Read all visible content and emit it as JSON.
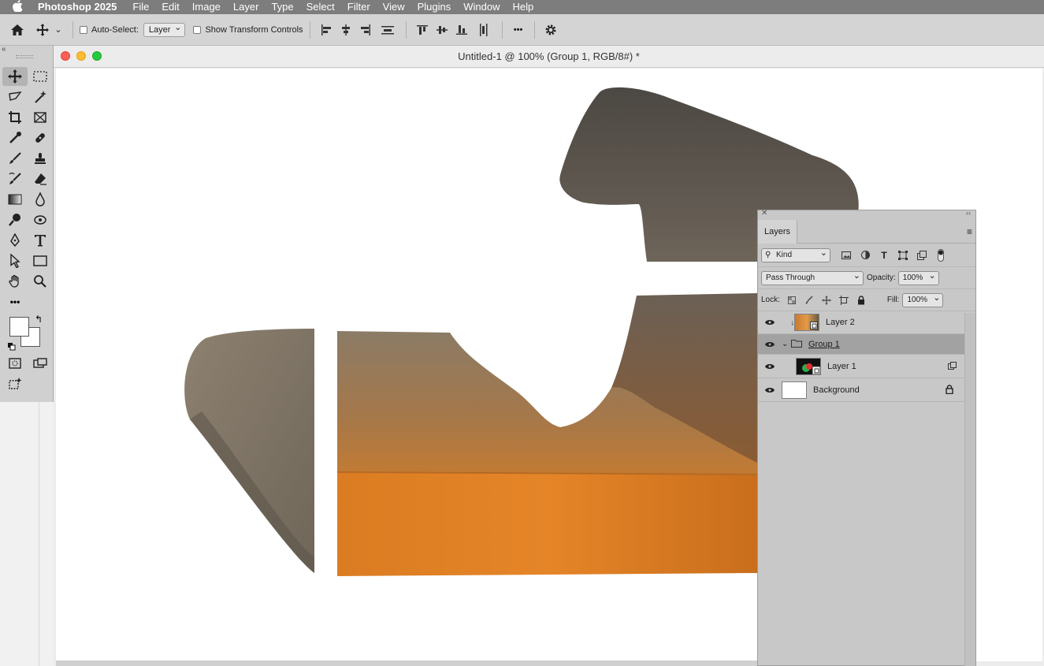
{
  "menubar": {
    "app_name": "Photoshop 2025",
    "items": [
      "File",
      "Edit",
      "Image",
      "Layer",
      "Type",
      "Select",
      "Filter",
      "View",
      "Plugins",
      "Window",
      "Help"
    ]
  },
  "options_bar": {
    "auto_select_label": "Auto-Select:",
    "auto_select_target": "Layer",
    "show_transform_label": "Show Transform Controls",
    "more_label": "•••"
  },
  "document": {
    "title": "Untitled-1 @ 100% (Group 1, RGB/8#) *"
  },
  "layers_panel": {
    "tab_label": "Layers",
    "filter_kind": "Kind",
    "blend_mode": "Pass Through",
    "opacity_label": "Opacity:",
    "opacity_value": "100%",
    "lock_label": "Lock:",
    "fill_label": "Fill:",
    "fill_value": "100%",
    "layers": [
      {
        "name": "Layer 2",
        "visible": true,
        "clipped": true
      },
      {
        "name": "Group 1",
        "visible": true,
        "group": true,
        "selected": true
      },
      {
        "name": "Layer 1",
        "visible": true
      },
      {
        "name": "Background",
        "visible": true,
        "locked": true
      }
    ]
  },
  "colors": {
    "menubar_bg": "#7d7d7d",
    "panel_bg": "#c8c8c8",
    "selected_row": "#a2a2a2",
    "foreground": "#ffffff",
    "background": "#ffffff"
  }
}
